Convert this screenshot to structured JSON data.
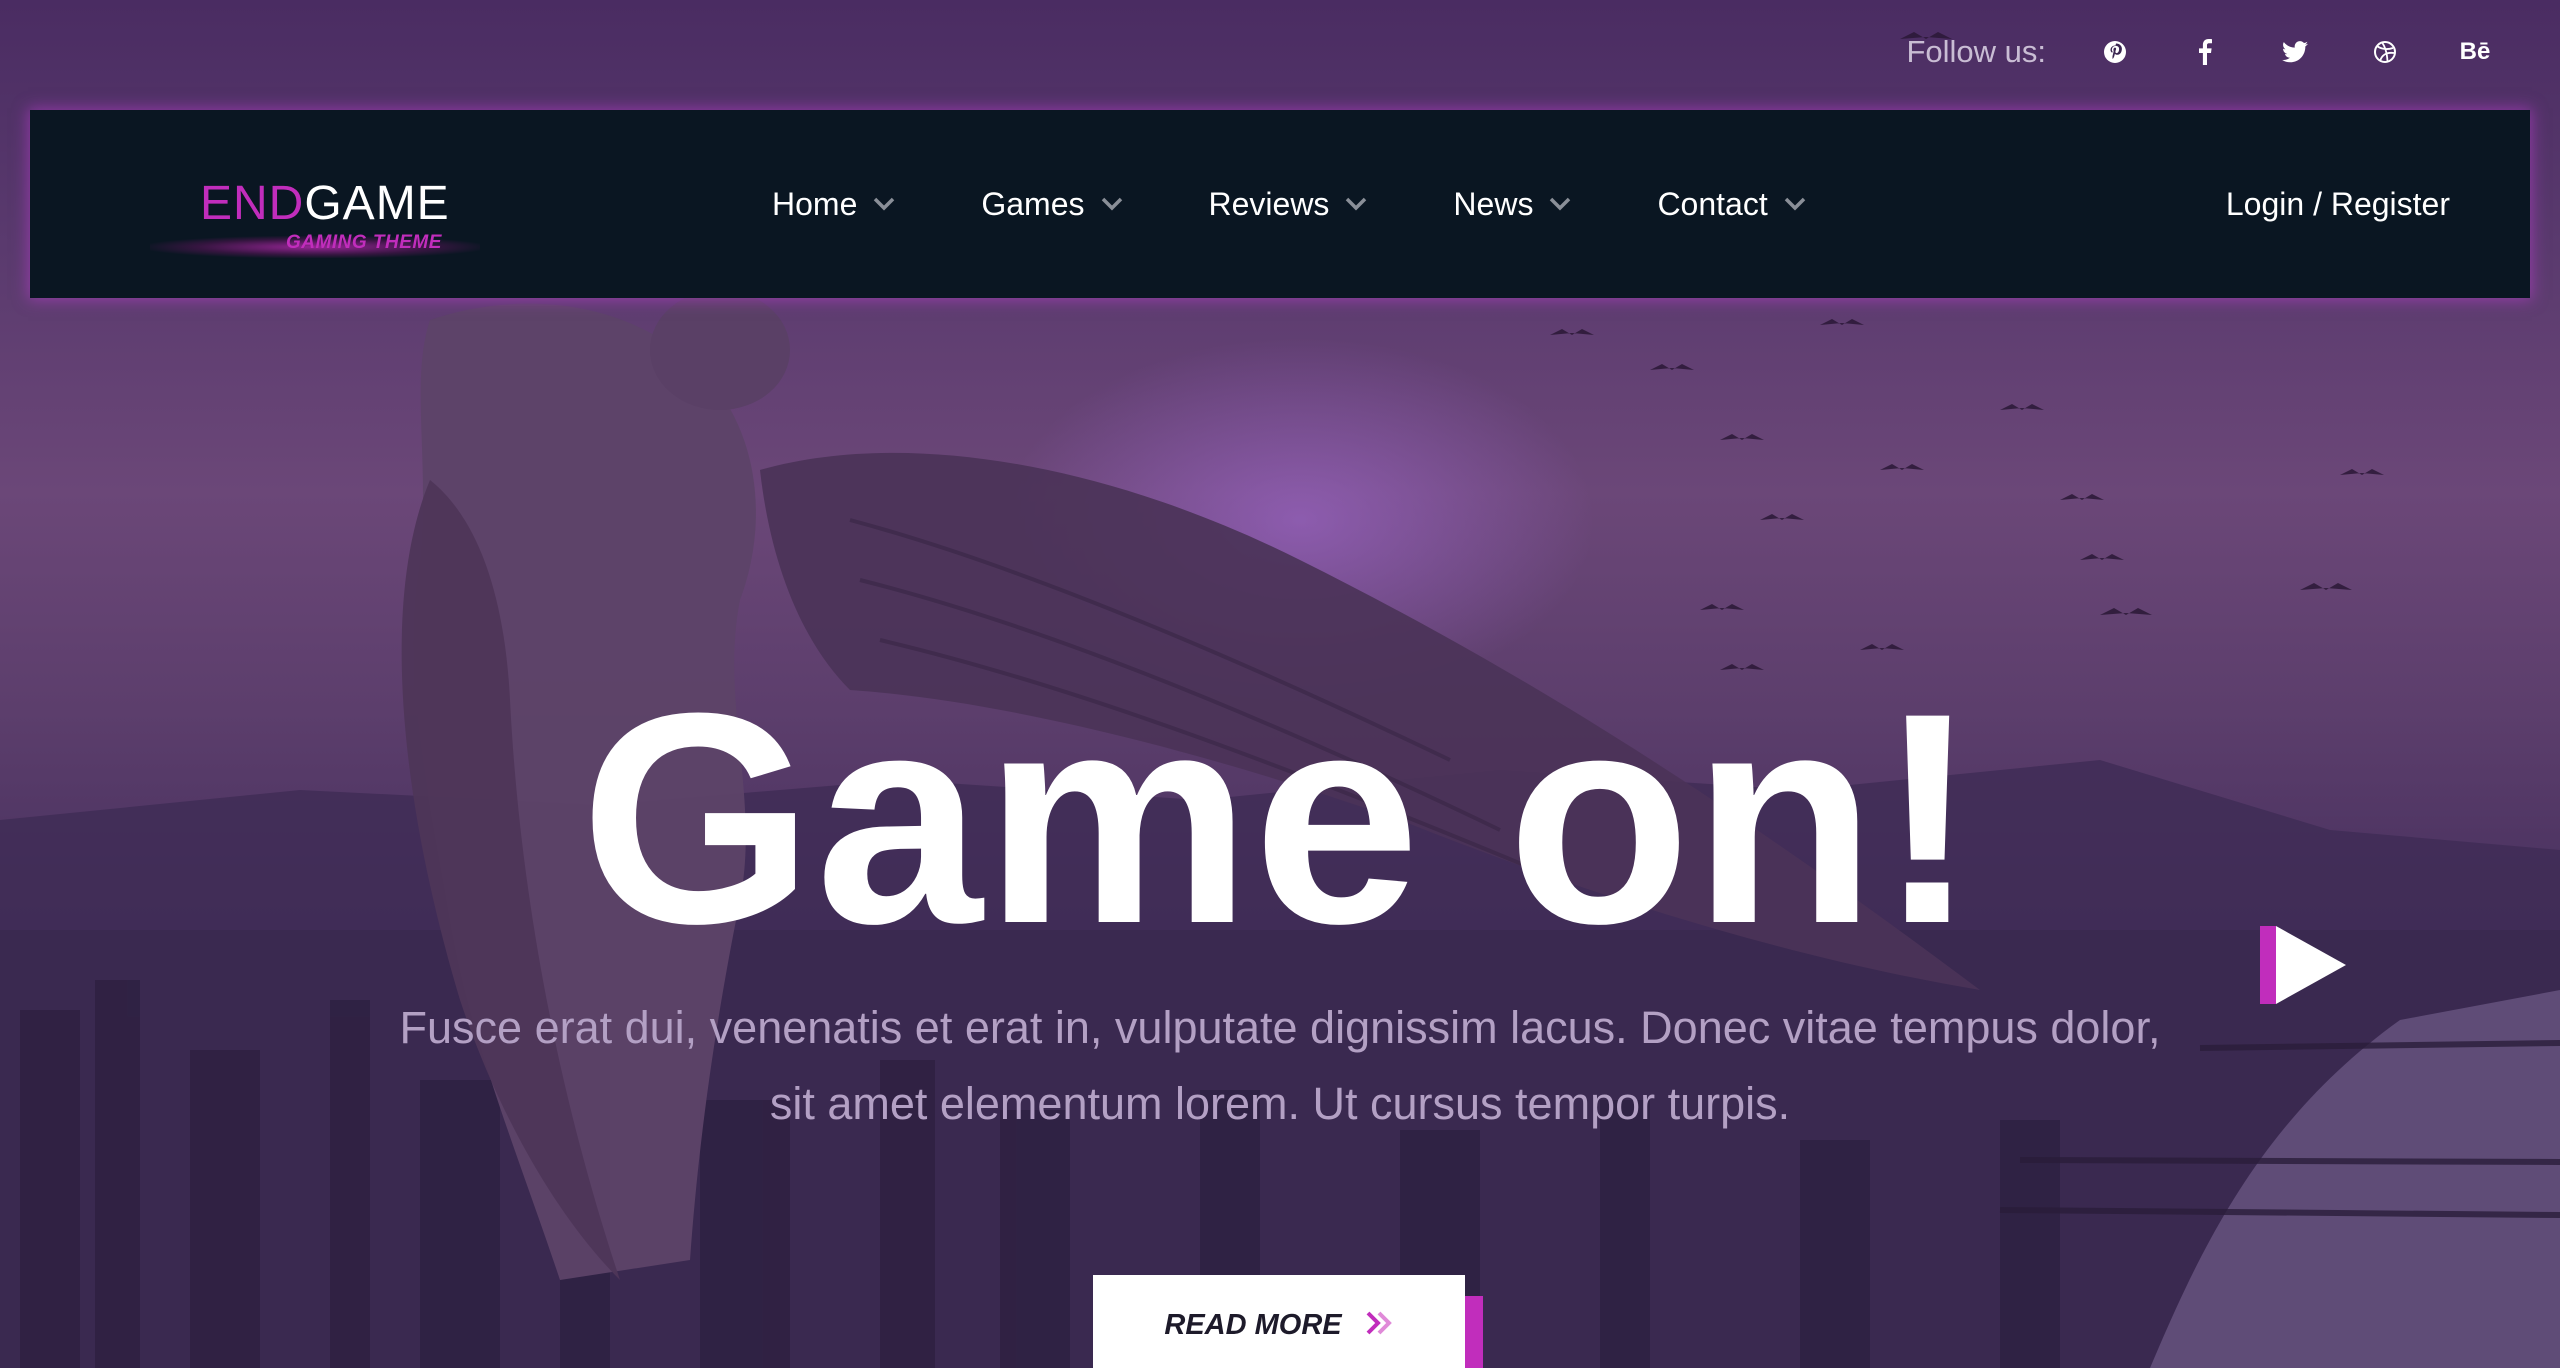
{
  "social": {
    "follow_label": "Follow us:",
    "icons": [
      "pinterest-icon",
      "facebook-icon",
      "twitter-icon",
      "dribbble-icon",
      "behance-icon"
    ],
    "behance_text": "Bē"
  },
  "logo": {
    "part1": "END",
    "part2": "GAME",
    "tagline": "GAMING THEME"
  },
  "nav": {
    "items": [
      {
        "label": "Home"
      },
      {
        "label": "Games"
      },
      {
        "label": "Reviews"
      },
      {
        "label": "News"
      },
      {
        "label": "Contact"
      }
    ],
    "login_label": "Login / Register"
  },
  "hero": {
    "title": "Game on!",
    "subtitle_line1": "Fusce erat dui, venenatis et erat in, vulputate dignissim lacus. Donec vitae tempus dolor,",
    "subtitle_line2": "sit amet elementum lorem. Ut cursus tempor turpis.",
    "cta_label": "READ MORE"
  },
  "colors": {
    "accent": "#c12dbc",
    "nav_bg": "#0a1622",
    "subtitle": "#b3a0c4"
  }
}
